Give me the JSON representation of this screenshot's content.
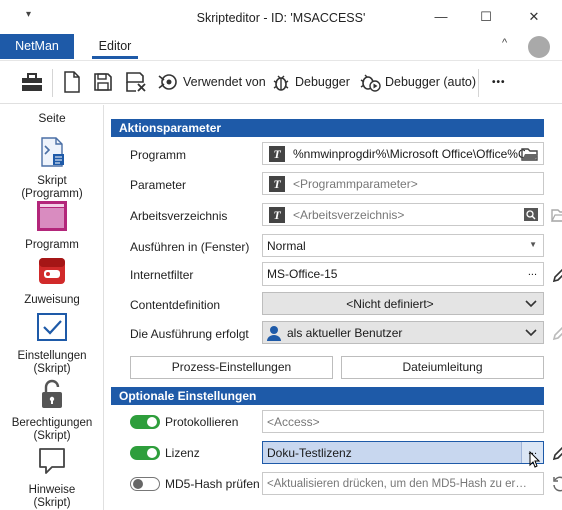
{
  "window": {
    "title": "Skripteditor - ID: 'MSACCESS'",
    "pin_glyph": "▾",
    "minimize": "—",
    "maximize": "☐",
    "close": "✕"
  },
  "tabs": {
    "netman": "NetMan",
    "editor": "Editor",
    "collapse_glyph": "^"
  },
  "toolbar": {
    "used_by_label": "Verwendet von",
    "debugger_label": "Debugger",
    "debugger_auto_label": "Debugger (auto)",
    "more_label": "•••"
  },
  "sidebar": {
    "heading": "Seite",
    "items": [
      {
        "label": "Skript\n(Programm)",
        "icon": "script-page-icon"
      },
      {
        "label": "Programm",
        "icon": "program-window-icon"
      },
      {
        "label": "Zuweisung",
        "icon": "assignment-icon"
      },
      {
        "label": "Einstellungen\n(Skript)",
        "icon": "checkmark-icon"
      },
      {
        "label": "Berechtigungen\n(Skript)",
        "icon": "unlock-icon"
      },
      {
        "label": "Hinweise\n(Skript)",
        "icon": "speech-bubble-icon"
      }
    ]
  },
  "action_params": {
    "heading": "Aktionsparameter",
    "programm_label": "Programm",
    "programm_value": "%nmwinprogdir%\\Microsoft Office\\Office%Off",
    "parameter_label": "Parameter",
    "parameter_placeholder": "<Programmparameter>",
    "workdir_label": "Arbeitsverzeichnis",
    "workdir_placeholder": "<Arbeitsverzeichnis>",
    "run_in_label": "Ausführen in (Fenster)",
    "run_in_value": "Normal",
    "internetfilter_label": "Internetfilter",
    "internetfilter_value": "MS-Office-15",
    "contentdef_label": "Contentdefinition",
    "contentdef_value": "<Nicht definiert>",
    "execution_label": "Die Ausführung erfolgt",
    "execution_value": "als aktueller Benutzer",
    "process_settings_button": "Prozess-Einstellungen",
    "file_redirect_button": "Dateiumleitung",
    "t_glyph": "T",
    "ellipsis": "..."
  },
  "optional": {
    "heading": "Optionale Einstellungen",
    "protokoll_label": "Protokollieren",
    "protokoll_value": "<Access>",
    "protokoll_on": true,
    "lizenz_label": "Lizenz",
    "lizenz_value": "Doku-Testlizenz",
    "lizenz_on": true,
    "md5_label": "MD5-Hash prüfen",
    "md5_placeholder": "<Aktualisieren drücken, um den MD5-Hash zu er…",
    "md5_on": false
  },
  "colors": {
    "accent": "#1e5aa8",
    "toggle_on": "#2e9e3c",
    "program_icon": "#b3267a",
    "assign_icon": "#d12a2a"
  }
}
